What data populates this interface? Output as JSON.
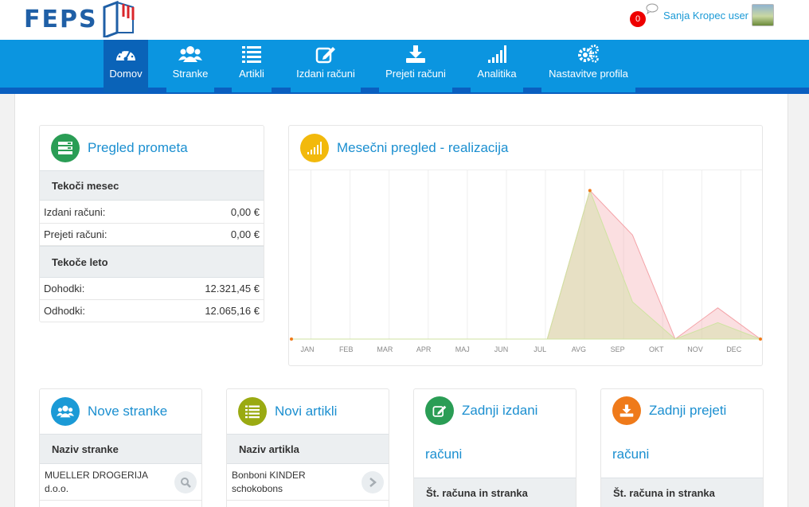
{
  "header": {
    "logo_text": "FEPS",
    "notification_count": "0",
    "user_name": "Sanja Kropec user"
  },
  "nav": {
    "items": [
      {
        "label": "Domov",
        "icon": "dashboard-icon",
        "active": true
      },
      {
        "label": "Stranke",
        "icon": "users-icon"
      },
      {
        "label": "Artikli",
        "icon": "list-icon"
      },
      {
        "label": "Izdani računi",
        "icon": "edit-icon"
      },
      {
        "label": "Prejeti računi",
        "icon": "download-icon"
      },
      {
        "label": "Analitika",
        "icon": "signal-icon"
      },
      {
        "label": "Nastavitve profila",
        "icon": "gears-icon"
      }
    ]
  },
  "turnover": {
    "title": "Pregled prometa",
    "current_month": {
      "heading": "Tekoči mesec",
      "rows": [
        {
          "label": "Izdani računi:",
          "value": "0,00 €"
        },
        {
          "label": "Prejeti računi:",
          "value": "0,00 €"
        }
      ]
    },
    "current_year": {
      "heading": "Tekoče leto",
      "rows": [
        {
          "label": "Dohodki:",
          "value": "12.321,45 €"
        },
        {
          "label": "Odhodki:",
          "value": "12.065,16 €"
        }
      ]
    }
  },
  "monthly": {
    "title": "Mesečni pregled - realizacija"
  },
  "chart_data": {
    "type": "area",
    "categories": [
      "JAN",
      "FEB",
      "MAR",
      "APR",
      "MAJ",
      "JUN",
      "JUL",
      "AVG",
      "SEP",
      "OKT",
      "NOV",
      "DEC"
    ],
    "series": [
      {
        "values": [
          0,
          0,
          0,
          0,
          0,
          0,
          0,
          1.0,
          0.7,
          0,
          0.21,
          0
        ],
        "color": "#f4a3a8"
      },
      {
        "values": [
          0,
          0,
          0,
          0,
          0,
          0,
          0,
          1.0,
          0.25,
          0,
          0.11,
          0
        ],
        "color": "#cfe3a1"
      }
    ],
    "ylim": [
      0,
      1.05
    ],
    "grid": true
  },
  "new_clients": {
    "title": "Nove stranke",
    "column": "Naziv stranke",
    "items": [
      "MUELLER DROGERIJA d.o.o."
    ]
  },
  "new_items": {
    "title": "Novi artikli",
    "column": "Naziv artikla",
    "items": [
      "Bonboni KINDER schokobons"
    ]
  },
  "last_issued": {
    "title_line1": "Zadnji izdani",
    "title_line2": "računi",
    "column": "Št. računa in stranka"
  },
  "last_received": {
    "title_line1": "Zadnji prejeti",
    "title_line2": "računi",
    "column": "Št. računa in stranka"
  },
  "colors": {
    "nav_blue": "#0b95e0",
    "nav_active": "#0a63b8",
    "title_blue": "#1b8fd0",
    "green": "#2a9d55",
    "yellow": "#f2b90c",
    "blue_circle": "#1b9ad6",
    "olive": "#9aaa12",
    "orange": "#ef7a1a"
  }
}
